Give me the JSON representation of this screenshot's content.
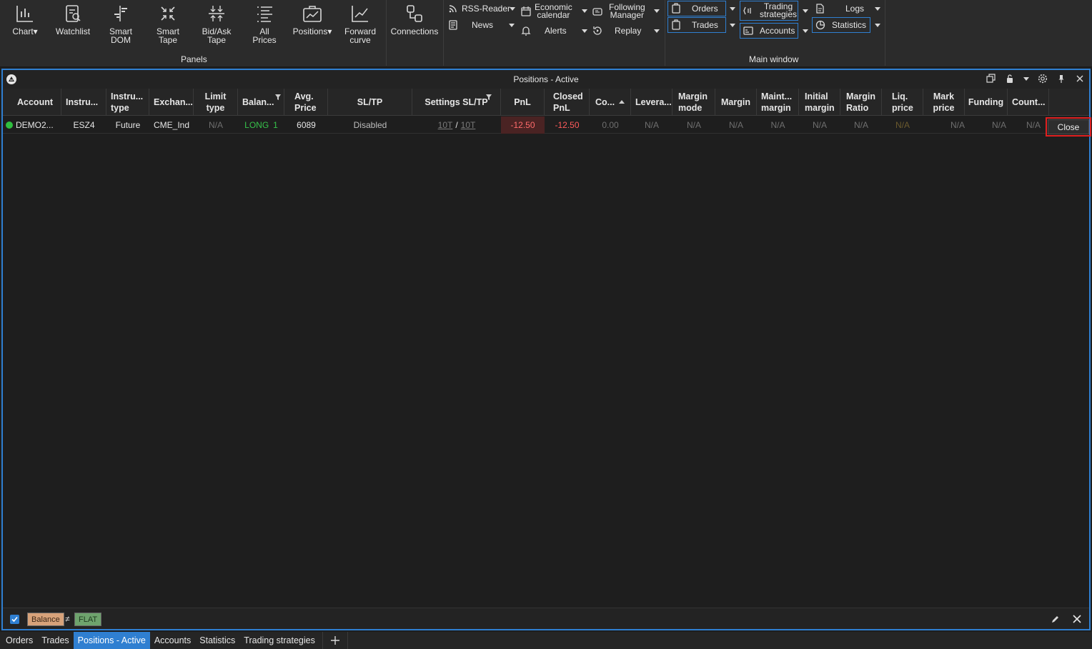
{
  "ribbon": {
    "panels": [
      {
        "name": "chart-button",
        "label": "Chart▾",
        "icon": "chart-icon"
      },
      {
        "name": "watchlist-button",
        "label": "Watchlist",
        "icon": "watchlist-icon"
      },
      {
        "name": "smart-dom-button",
        "label": "Smart\nDOM",
        "icon": "smart-dom-icon"
      },
      {
        "name": "smart-tape-button",
        "label": "Smart\nTape",
        "icon": "smart-tape-icon"
      },
      {
        "name": "bid-ask-tape-button",
        "label": "Bid/Ask\nTape",
        "icon": "bid-ask-tape-icon"
      },
      {
        "name": "all-prices-button",
        "label": "All\nPrices",
        "icon": "all-prices-icon"
      },
      {
        "name": "positions-button",
        "label": "Positions▾",
        "icon": "positions-icon"
      },
      {
        "name": "forward-curve-button",
        "label": "Forward\ncurve",
        "icon": "forward-curve-icon"
      }
    ],
    "panels_group_label": "Panels",
    "connections_label": "Connections",
    "rss_reader": "RSS-Reader",
    "news": "News",
    "economic_calendar": "Economic\ncalendar",
    "alerts": "Alerts",
    "following_manager": "Following\nManager",
    "replay": "Replay",
    "orders": "Orders",
    "trades": "Trades",
    "trading_strategies": "Trading\nstrategies",
    "accounts": "Accounts",
    "logs": "Logs",
    "statistics": "Statistics",
    "main_window_label": "Main window"
  },
  "window": {
    "title": "Positions - Active"
  },
  "table": {
    "headers": {
      "account": "Account",
      "instrument": "Instru...",
      "instrument_type": "Instru...\ntype",
      "exchange": "Exchan...",
      "limit_type": "Limit\ntype",
      "balance": "Balan...",
      "avg_price": "Avg.\nPrice",
      "sltp": "SL/TP",
      "settings_sltp": "Settings SL/TP",
      "pnl": "PnL",
      "closed_pnl": "Closed\nPnL",
      "commission": "Co...",
      "leverage": "Levera...",
      "margin_mode": "Margin\nmode",
      "margin": "Margin",
      "maint_margin": "Maint...\nmargin",
      "initial_margin": "Initial\nmargin",
      "margin_ratio": "Margin\nRatio",
      "liq_price": "Liq.\nprice",
      "mark_price": "Mark\nprice",
      "funding": "Funding",
      "count": "Count..."
    },
    "row": {
      "account": "DEMO2...",
      "instrument": "ESZ4",
      "instrument_type": "Future",
      "exchange": "CME_Ind",
      "limit_type": "N/A",
      "balance_side": "LONG",
      "balance_qty": "1",
      "avg_price": "6089",
      "sltp": "Disabled",
      "sl": "10T",
      "tp_sep": "/",
      "tp": "10T",
      "pnl": "-12.50",
      "closed_pnl": "-12.50",
      "commission": "0.00",
      "leverage": "N/A",
      "margin_mode": "N/A",
      "margin": "N/A",
      "maint_margin": "N/A",
      "initial_margin": "N/A",
      "margin_ratio": "N/A",
      "liq_price": "N/A",
      "mark_price": "N/A",
      "funding": "N/A",
      "count": "N/A",
      "close_label": "Close"
    }
  },
  "filter": {
    "field": "Balance",
    "operator": "≠",
    "value": "FLAT"
  },
  "tabs": [
    "Orders",
    "Trades",
    "Positions - Active",
    "Accounts",
    "Statistics",
    "Trading strategies"
  ],
  "active_tab": "Positions - Active",
  "colors": {
    "accent": "#2f7fd1",
    "long": "#36c24a",
    "negative": "#ff5b5b",
    "highlight": "#e02020"
  }
}
